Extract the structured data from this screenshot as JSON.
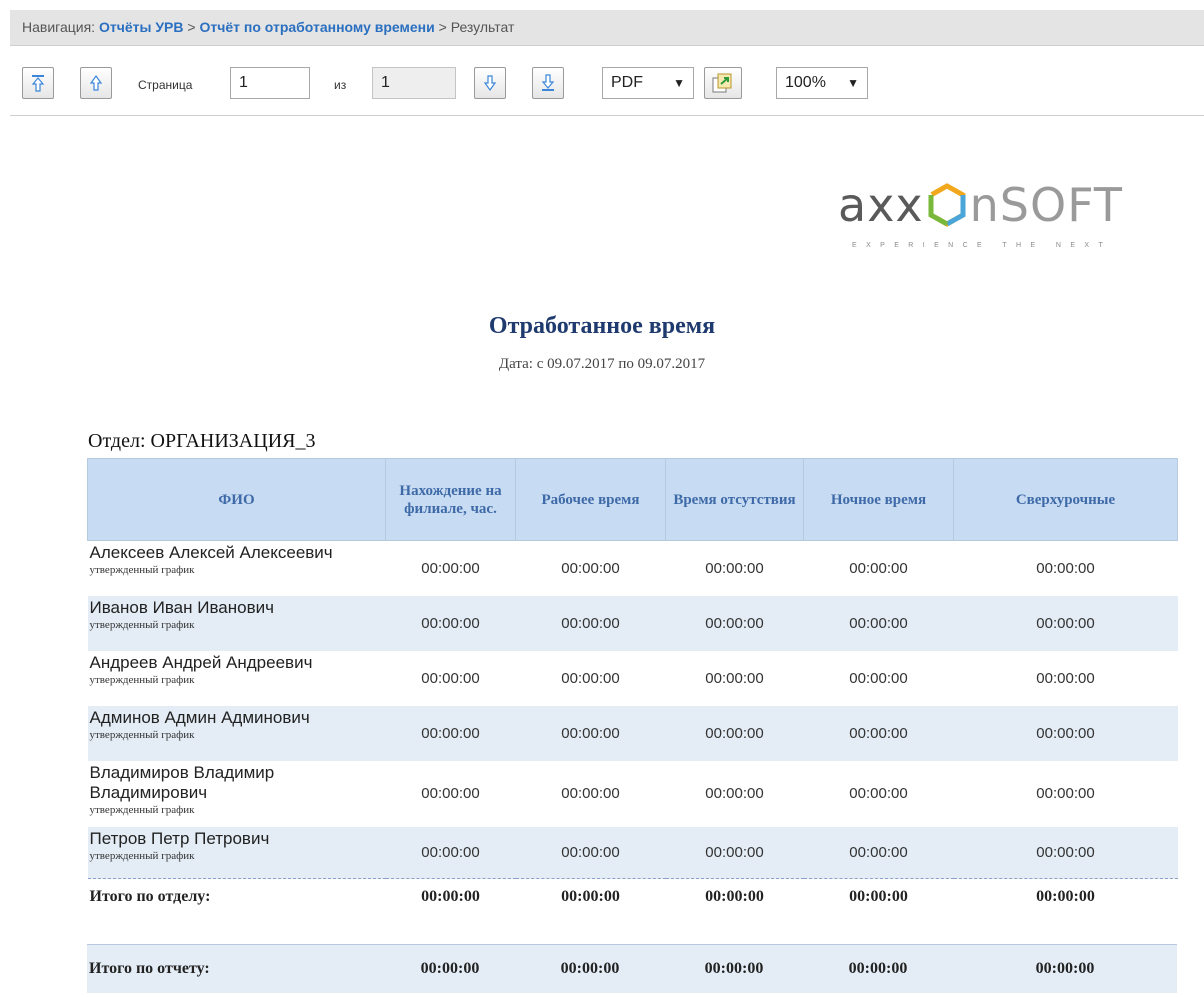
{
  "navigation": {
    "prefix": "Навигация:",
    "link1": "Отчёты УРВ",
    "sep": ">",
    "link2": "Отчёт по отработанному времени",
    "current": "Результат"
  },
  "toolbar": {
    "first_page_icon": "first-page-icon",
    "prev_page_icon": "prev-page-icon",
    "page_label": "Страница",
    "page_value": "1",
    "of_label": "из",
    "total_pages": "1",
    "next_page_icon": "next-page-icon",
    "last_page_icon": "last-page-icon",
    "format_value": "PDF",
    "export_icon": "export-icon",
    "zoom_value": "100%",
    "caret": "▼"
  },
  "logo": {
    "word_main": "axx",
    "word_soft": "nSOFT",
    "tagline": "EXPERIENCE THE NEXT"
  },
  "report": {
    "title": "Отработанное время",
    "date": "Дата: с 09.07.2017 по 09.07.2017",
    "department": "Отдел: ОРГАНИЗАЦИЯ_3",
    "columns": [
      "ФИО",
      "Нахождение на филиале, час.",
      "Рабочее время",
      "Время отсутствия",
      "Ночное время",
      "Сверхурочные"
    ],
    "rows": [
      {
        "name": "Алексеев Алексей Алексеевич",
        "schedule": "утвержденный график",
        "values": [
          "00:00:00",
          "00:00:00",
          "00:00:00",
          "00:00:00",
          "00:00:00"
        ]
      },
      {
        "name": "Иванов Иван Иванович",
        "schedule": "утвержденный график",
        "values": [
          "00:00:00",
          "00:00:00",
          "00:00:00",
          "00:00:00",
          "00:00:00"
        ]
      },
      {
        "name": "Андреев Андрей Андреевич",
        "schedule": "утвержденный график",
        "values": [
          "00:00:00",
          "00:00:00",
          "00:00:00",
          "00:00:00",
          "00:00:00"
        ]
      },
      {
        "name": "Админов Админ Админович",
        "schedule": "утвержденный график",
        "values": [
          "00:00:00",
          "00:00:00",
          "00:00:00",
          "00:00:00",
          "00:00:00"
        ]
      },
      {
        "name": "Владимиров Владимир Владимирович",
        "schedule": "утвержденный график",
        "values": [
          "00:00:00",
          "00:00:00",
          "00:00:00",
          "00:00:00",
          "00:00:00"
        ]
      },
      {
        "name": "Петров Петр Петрович",
        "schedule": "утвержденный график",
        "values": [
          "00:00:00",
          "00:00:00",
          "00:00:00",
          "00:00:00",
          "00:00:00"
        ]
      }
    ],
    "dept_total_label": "Итого по отделу:",
    "dept_total_values": [
      "00:00:00",
      "00:00:00",
      "00:00:00",
      "00:00:00",
      "00:00:00"
    ],
    "report_total_label": "Итого по отчету:",
    "report_total_values": [
      "00:00:00",
      "00:00:00",
      "00:00:00",
      "00:00:00",
      "00:00:00"
    ]
  },
  "colors": {
    "header_bg": "#c7dbf2",
    "header_text": "#3f6aa8",
    "alt_row": "#e4edf6",
    "nav_link": "#2a6fc0",
    "title": "#1f3a6e"
  }
}
